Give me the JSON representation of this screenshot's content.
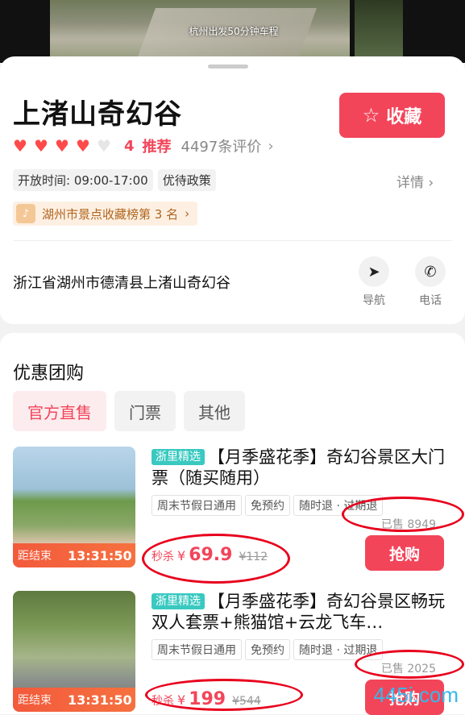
{
  "hero": {
    "caption": "杭州出发50分钟车程"
  },
  "attraction": {
    "title": "上渚山奇幻谷",
    "favorite_label": "收藏",
    "rating": {
      "hearts_filled": 4,
      "hearts_total": 5,
      "score": "4",
      "recommend_label": "推荐",
      "reviews": "4497条评价"
    },
    "tags": [
      "开放时间: 09:00-17:00",
      "优待政策"
    ],
    "details_label": "详情",
    "rank": "湖州市景点收藏榜第 3 名",
    "address": "浙江省湖州市德清县上渚山奇幻谷",
    "nav_label": "导航",
    "phone_label": "电话"
  },
  "deals": {
    "section_title": "优惠团购",
    "tabs": [
      "官方直售",
      "门票",
      "其他"
    ],
    "active_tab": 0,
    "items": [
      {
        "badge": "浙里精选",
        "title": "【月季盛花季】奇幻谷景区大门票（随买随用）",
        "tags": [
          "周末节假日通用",
          "免预约",
          "随时退 · 过期退"
        ],
        "sold": "已售 8949",
        "price_prefix": "秒杀",
        "currency": "¥",
        "price": "69.9",
        "original_price": "¥112",
        "buy_label": "抢购",
        "timer_label": "距结束",
        "timer": "13:31:50"
      },
      {
        "badge": "浙里精选",
        "title": "【月季盛花季】奇幻谷景区畅玩双人套票+熊猫馆+云龙飞车…",
        "tags": [
          "周末节假日通用",
          "免预约",
          "随时退 · 过期退"
        ],
        "sold": "已售 2025",
        "price_prefix": "秒杀",
        "currency": "¥",
        "price": "199",
        "original_price": "¥544",
        "buy_label": "抢购",
        "timer_label": "距结束",
        "timer": "13:31:50"
      }
    ]
  },
  "watermark": "445i.com",
  "colors": {
    "accent": "#f2455a",
    "badge": "#39c9c0",
    "annotation": "#e8001c"
  }
}
